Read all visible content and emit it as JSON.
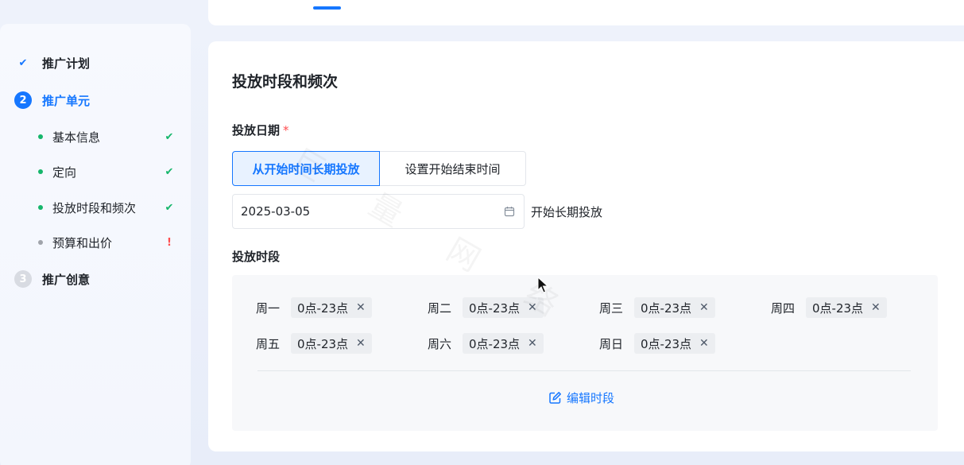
{
  "sidebar": {
    "steps": [
      {
        "label": "推广计划",
        "marker": "✔",
        "state": "done"
      },
      {
        "label": "推广单元",
        "marker": "2",
        "state": "active"
      },
      {
        "label": "推广创意",
        "marker": "3",
        "state": "todo"
      }
    ],
    "sub_items": [
      {
        "label": "基本信息",
        "state": "✔"
      },
      {
        "label": "定向",
        "state": "✔"
      },
      {
        "label": "投放时段和频次",
        "state": "✔"
      },
      {
        "label": "预算和出价",
        "state": "!"
      }
    ]
  },
  "main": {
    "section_title": "投放时段和频次",
    "date_label": "投放日期",
    "required_mark": "*",
    "date_mode_options": [
      "从开始时间长期投放",
      "设置开始结束时间"
    ],
    "date_mode_selected": "从开始时间长期投放",
    "start_date": "2025-03-05",
    "date_suffix": "开始长期投放",
    "period_label": "投放时段",
    "schedule": [
      {
        "day": "周一",
        "range": "0点-23点"
      },
      {
        "day": "周二",
        "range": "0点-23点"
      },
      {
        "day": "周三",
        "range": "0点-23点"
      },
      {
        "day": "周四",
        "range": "0点-23点"
      },
      {
        "day": "周五",
        "range": "0点-23点"
      },
      {
        "day": "周六",
        "range": "0点-23点"
      },
      {
        "day": "周日",
        "range": "0点-23点"
      }
    ],
    "edit_label": "编辑时段",
    "tag_close": "✕"
  },
  "watermark": "巨 量 网 络",
  "colors": {
    "accent": "#1677ff",
    "success": "#15b66b",
    "danger": "#ff4d4f"
  }
}
